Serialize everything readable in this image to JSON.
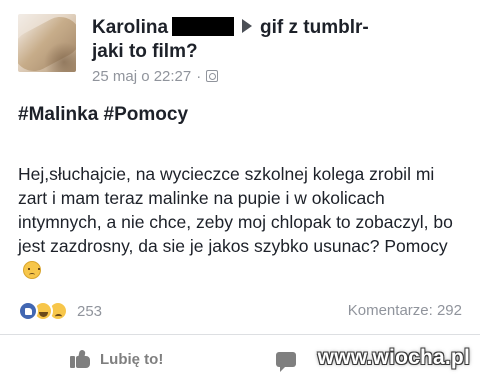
{
  "post": {
    "author": "Karolina",
    "group_title": "gif z tumblr-",
    "group_title_cont": "jaki to film?",
    "timestamp": "25 maj o 22:27",
    "separator": "·",
    "privacy_icon": "globe-icon",
    "hashtags": "#Malinka #Pomocy",
    "body": "Hej,słuchajcie, na wycieczce szkolnej kolega zrobil mi zart i mam teraz malinke na pupie i w okolicach intymnych, a nie chce, zeby moj chlopak to zobaczyl, bo jest zazdrosny, da sie je jakos szybko usunac? Pomocy",
    "body_emoji": "sad-icon"
  },
  "footer": {
    "reaction_count": "253",
    "reaction_icons": [
      "like-icon",
      "haha-icon",
      "sad-icon"
    ],
    "comments_label": "Komentarze: 292",
    "like_label": "Lubię to!"
  },
  "watermark": "www.wiocha.pl",
  "colors": {
    "text": "#1d2129",
    "meta": "#90949c",
    "like_blue": "#4267b2",
    "emoji_yellow": "#f7c64a"
  }
}
